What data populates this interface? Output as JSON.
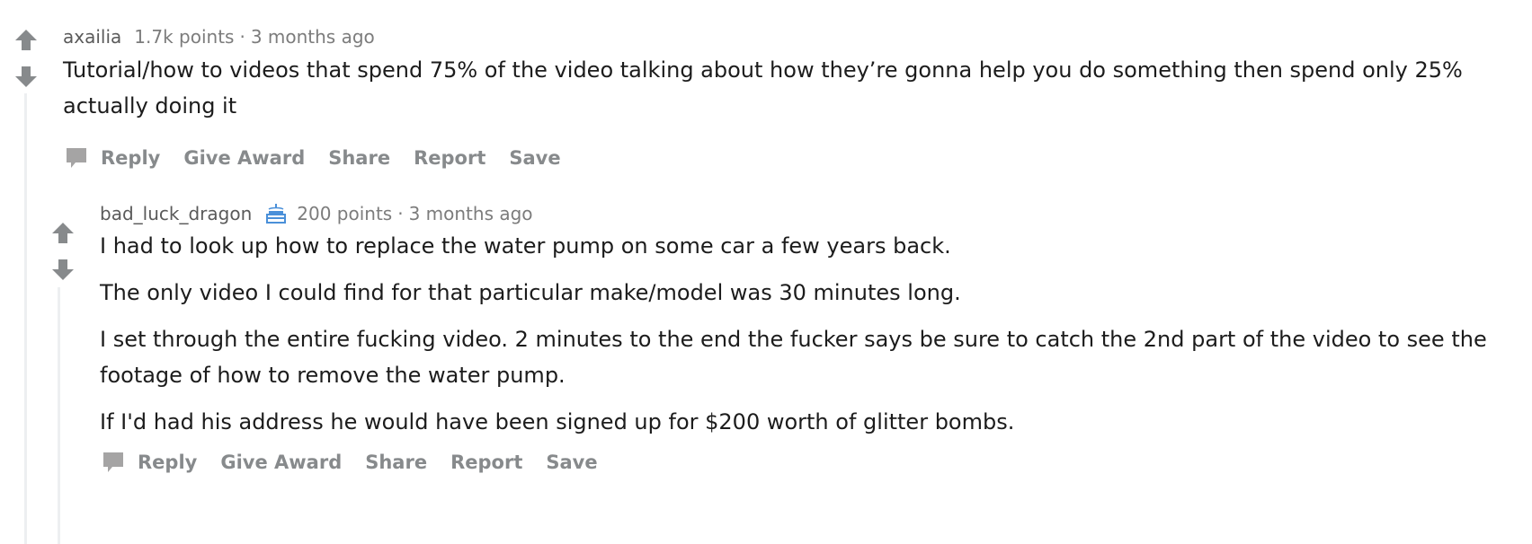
{
  "comments": [
    {
      "author": "axailia",
      "points": "1.7k points",
      "separator": "·",
      "time": "3 months ago",
      "paragraphs": [
        "Tutorial/how to videos that spend 75% of the video talking about how they’re gonna help you do something then spend only 25% actually doing it"
      ],
      "actions": {
        "reply": "Reply",
        "give_award": "Give Award",
        "share": "Share",
        "report": "Report",
        "save": "Save"
      }
    },
    {
      "author": "bad_luck_dragon",
      "flair_icon": "cake-icon",
      "points": "200 points",
      "separator": "·",
      "time": "3 months ago",
      "paragraphs": [
        "I had to look up how to replace the water pump on some car a few years back.",
        "The only video I could find for that particular make/model was 30 minutes long.",
        "I set through the entire fucking video. 2 minutes to the end the fucker says be sure to catch the 2nd part of the video to see the footage of how to remove the water pump.",
        "If I'd had his address he would have been signed up for $200 worth of glitter bombs."
      ],
      "actions": {
        "reply": "Reply",
        "give_award": "Give Award",
        "share": "Share",
        "report": "Report",
        "save": "Save"
      }
    }
  ],
  "colors": {
    "vote_arrow": "#878a8c",
    "meta_text": "#7c7c7c",
    "body_text": "#1c1c1c",
    "action_text": "#878a8c",
    "flair_blue": "#4a90d9",
    "thread_line": "#edeff1"
  }
}
